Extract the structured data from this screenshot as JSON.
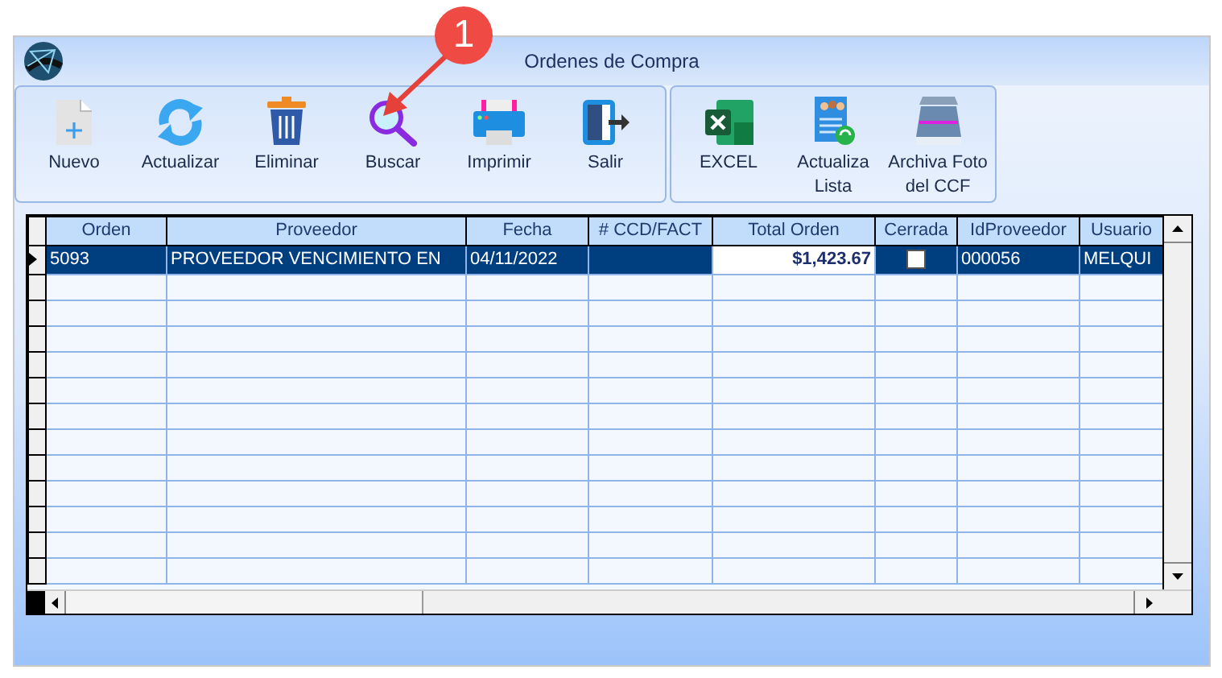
{
  "window": {
    "title": "Ordenes de Compra"
  },
  "toolbar_groups": [
    {
      "buttons": [
        {
          "label": "Nuevo",
          "kind": "new"
        },
        {
          "label": "Actualizar",
          "kind": "refresh"
        },
        {
          "label": "Eliminar",
          "kind": "trash"
        },
        {
          "label": "Buscar",
          "kind": "search"
        },
        {
          "label": "Imprimir",
          "kind": "print"
        },
        {
          "label": "Salir",
          "kind": "exit"
        }
      ]
    },
    {
      "buttons": [
        {
          "label": "EXCEL",
          "kind": "excel"
        },
        {
          "label": "Actualiza Lista",
          "kind": "list"
        },
        {
          "label": "Archiva Foto del CCF",
          "kind": "scanner"
        }
      ]
    }
  ],
  "table": {
    "columns": [
      "Orden",
      "Proveedor",
      "Fecha",
      "# CCD/FACT",
      "Total Orden",
      "Cerrada",
      "IdProveedor",
      "Usuario"
    ],
    "rows": [
      {
        "selected": true,
        "orden": "5093",
        "proveedor": "PROVEEDOR VENCIMIENTO EN",
        "fecha": "04/11/2022",
        "total": "$1,423.67",
        "cerrada": false,
        "id_proveedor": "000056",
        "usuario": "MELQUI"
      }
    ]
  },
  "annotation": {
    "badge": "1"
  }
}
